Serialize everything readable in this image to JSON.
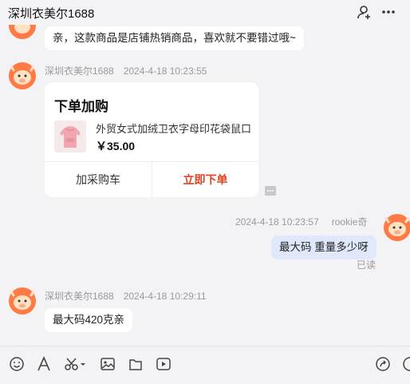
{
  "window": {
    "title": "深圳衣美尔1688"
  },
  "messages": {
    "m1": {
      "text": "亲，这款商品是店铺热销商品，喜欢就不要错过哦~"
    },
    "m2": {
      "sender": "深圳衣美尔1688",
      "time": "2024-4-18 10:23:55"
    },
    "card": {
      "title": "下单加购",
      "product_name": "外贸女式加绒卫衣字母印花袋鼠口",
      "price": "￥35.00",
      "cart_label": "加采购车",
      "buy_label": "立即下单"
    },
    "m3": {
      "time": "2024-4-18 10:23:57",
      "sender": "rookie奇",
      "text": "最大码 重量多少呀",
      "status": "已读"
    },
    "m4": {
      "sender": "深圳衣美尔1688",
      "time": "2024-4-18 10:29:11",
      "text": "最大码420克亲"
    }
  },
  "icons": {
    "title_bar": [
      "add-user-icon",
      "more-icon"
    ],
    "toolbar": [
      "emoji-icon",
      "font-icon",
      "scissors-icon",
      "image-icon",
      "file-icon",
      "video-icon",
      "share-icon",
      "chat-icon"
    ]
  },
  "colors": {
    "buy_button": "#e5401f",
    "my_bubble": "#dfe9fb",
    "avatar": "#ff7a45"
  }
}
